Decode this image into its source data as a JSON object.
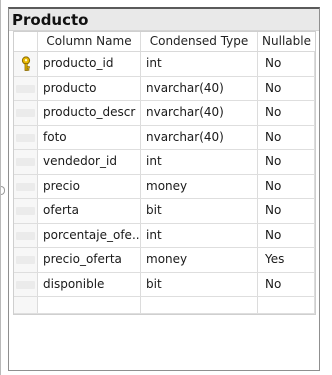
{
  "table": {
    "title": "Producto",
    "columns": [
      "Column Name",
      "Condensed Type",
      "Nullable"
    ],
    "rows": [
      {
        "name": "producto_id",
        "type": "int",
        "nullable": "No",
        "icon": "primary-key-icon"
      },
      {
        "name": "producto",
        "type": "nvarchar(40)",
        "nullable": "No"
      },
      {
        "name": "producto_descr",
        "type": "nvarchar(40)",
        "nullable": "No"
      },
      {
        "name": "foto",
        "type": "nvarchar(40)",
        "nullable": "No"
      },
      {
        "name": "vendedor_id",
        "type": "int",
        "nullable": "No"
      },
      {
        "name": "precio",
        "type": "money",
        "nullable": "No"
      },
      {
        "name": "oferta",
        "type": "bit",
        "nullable": "No"
      },
      {
        "name": "porcentaje_ofe...",
        "type": "int",
        "nullable": "No"
      },
      {
        "name": "precio_oferta",
        "type": "money",
        "nullable": "Yes"
      },
      {
        "name": "disponible",
        "type": "bit",
        "nullable": "No"
      }
    ]
  },
  "colors": {
    "title_bg": "#e9e9e9",
    "border": "#8f8f8f",
    "key_icon": "#d9a800"
  }
}
